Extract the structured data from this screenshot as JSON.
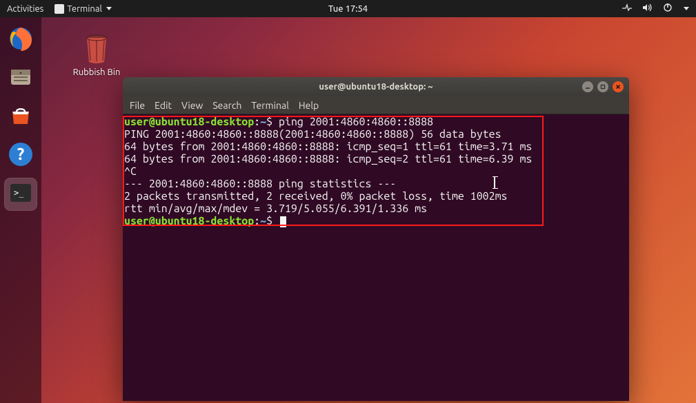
{
  "topbar": {
    "activities": "Activities",
    "app_label": "Terminal",
    "clock": "Tue 17:54"
  },
  "desktop": {
    "trash_label": "Rubbish Bin"
  },
  "terminal": {
    "title": "user@ubuntu18-desktop: ~",
    "menu": {
      "file": "File",
      "edit": "Edit",
      "view": "View",
      "search": "Search",
      "terminal": "Terminal",
      "help": "Help"
    },
    "prompt": {
      "user": "user",
      "host": "ubuntu18-desktop",
      "path": "~",
      "symbol": "$"
    },
    "command": "ping 2001:4860:4860::8888",
    "output": [
      "PING 2001:4860:4860::8888(2001:4860:4860::8888) 56 data bytes",
      "64 bytes from 2001:4860:4860::8888: icmp_seq=1 ttl=61 time=3.71 ms",
      "64 bytes from 2001:4860:4860::8888: icmp_seq=2 ttl=61 time=6.39 ms",
      "^C",
      "--- 2001:4860:4860::8888 ping statistics ---",
      "2 packets transmitted, 2 received, 0% packet loss, time 1002ms",
      "rtt min/avg/max/mdev = 3.719/5.055/6.391/1.336 ms"
    ]
  }
}
